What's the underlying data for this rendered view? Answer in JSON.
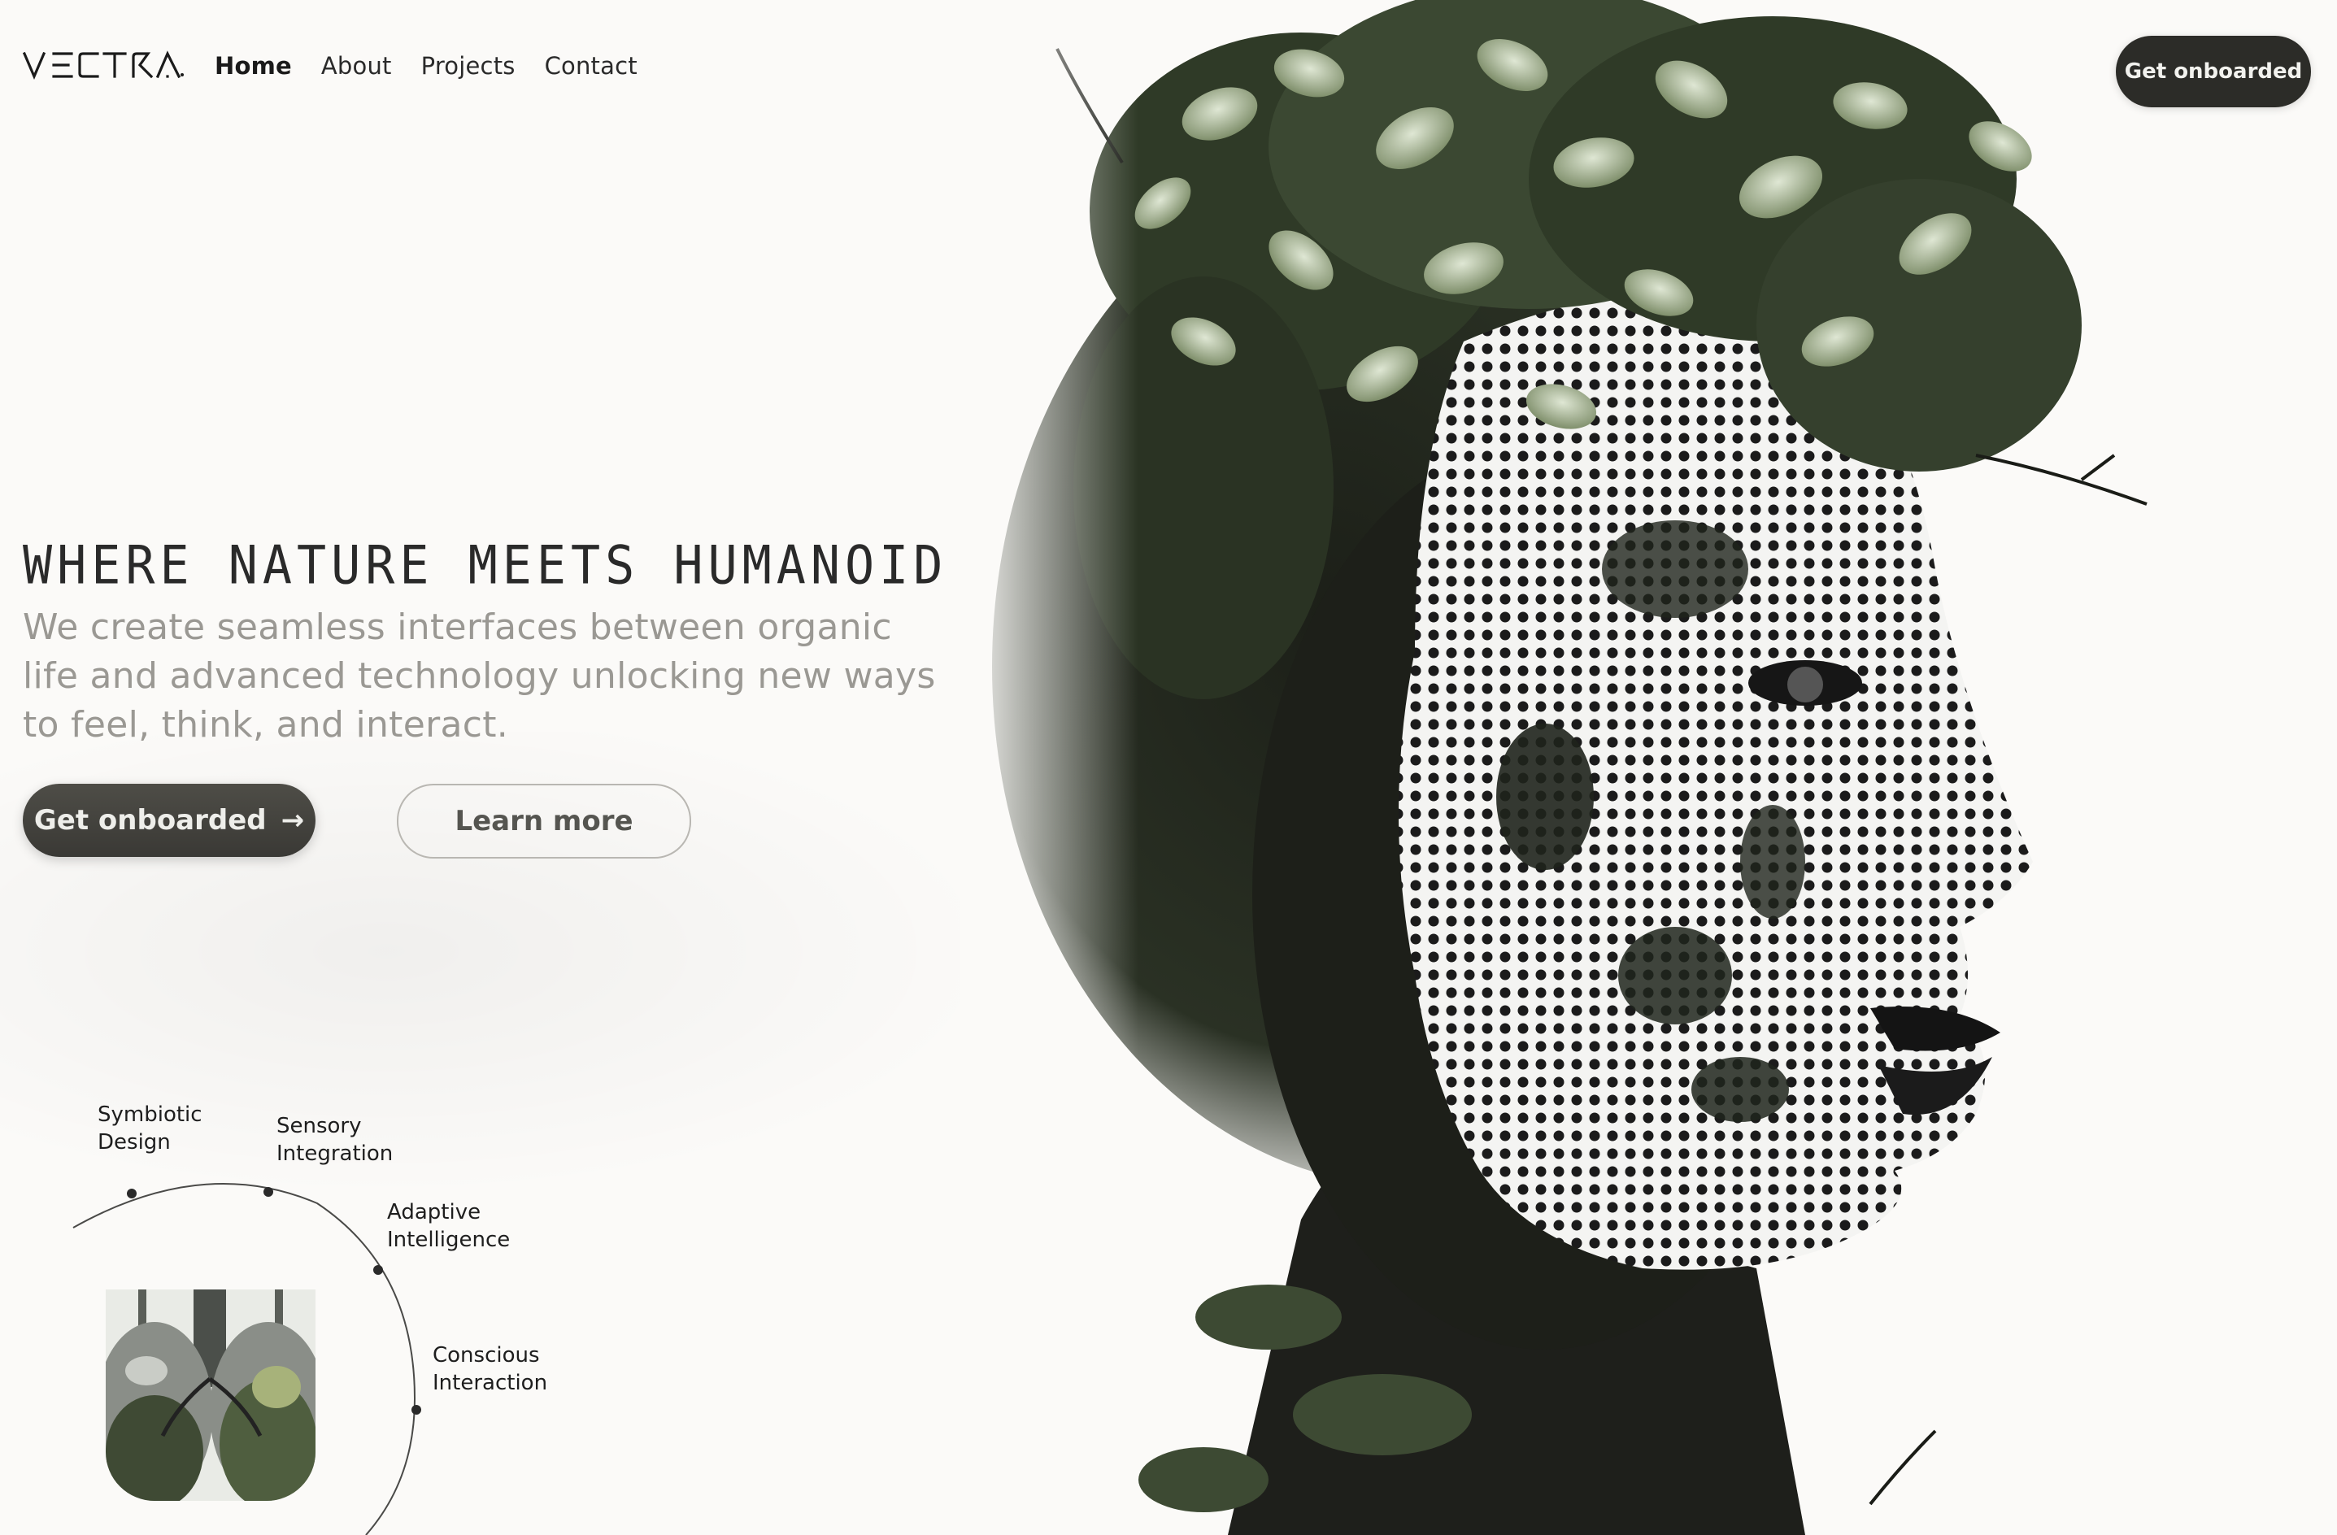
{
  "nav": {
    "logo_text": "VECTRA",
    "links": [
      {
        "label": "Home",
        "active": true
      },
      {
        "label": "About",
        "active": false
      },
      {
        "label": "Projects",
        "active": false
      },
      {
        "label": "Contact",
        "active": false
      }
    ],
    "cta_label": "Get onboarded"
  },
  "hero": {
    "headline": "WHERE NATURE MEETS HUMANOID",
    "subtitle": "We create seamless interfaces between organic life and advanced technology unlocking new ways to feel, think, and interact.",
    "primary_button": {
      "label": "Get onboarded",
      "icon": "arrow-right-icon"
    },
    "secondary_button": {
      "label": "Learn more"
    }
  },
  "features": [
    {
      "line1": "Symbiotic",
      "line2": "Design"
    },
    {
      "line1": "Sensory",
      "line2": "Integration"
    },
    {
      "line1": "Adaptive",
      "line2": "Intelligence"
    },
    {
      "line1": "Conscious",
      "line2": "Interaction"
    }
  ],
  "colors": {
    "background": "#fbfaf8",
    "dark_button": "#2c2c28",
    "subtitle_text": "#9a9893",
    "foliage": "#4f5e3f"
  }
}
